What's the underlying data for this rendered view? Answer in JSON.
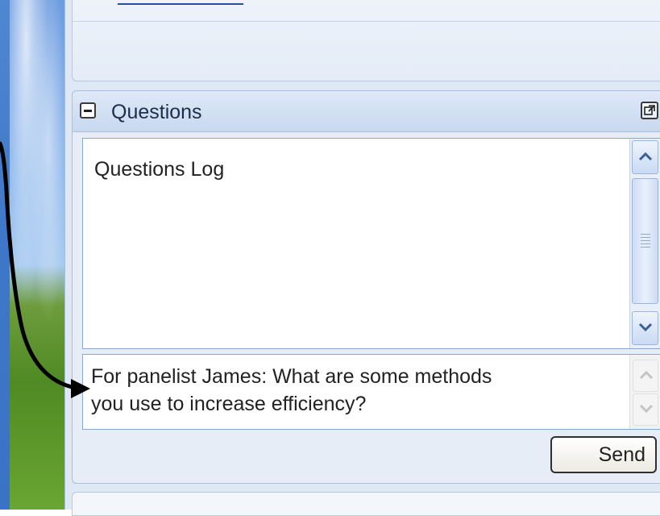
{
  "questions_panel": {
    "title": "Questions",
    "collapse_icon": "minus-icon",
    "popout_icon": "popout-icon",
    "log_label": "Questions Log",
    "question_input_value": "For panelist James: What are some methods\nyou use to increase efficiency?",
    "send_label": "Send"
  },
  "colors": {
    "panel_bg": "#dfe8f5",
    "header_bg": "#c7d8ef",
    "border": "#8aa6cc",
    "annotation_arrow": "#000000"
  }
}
